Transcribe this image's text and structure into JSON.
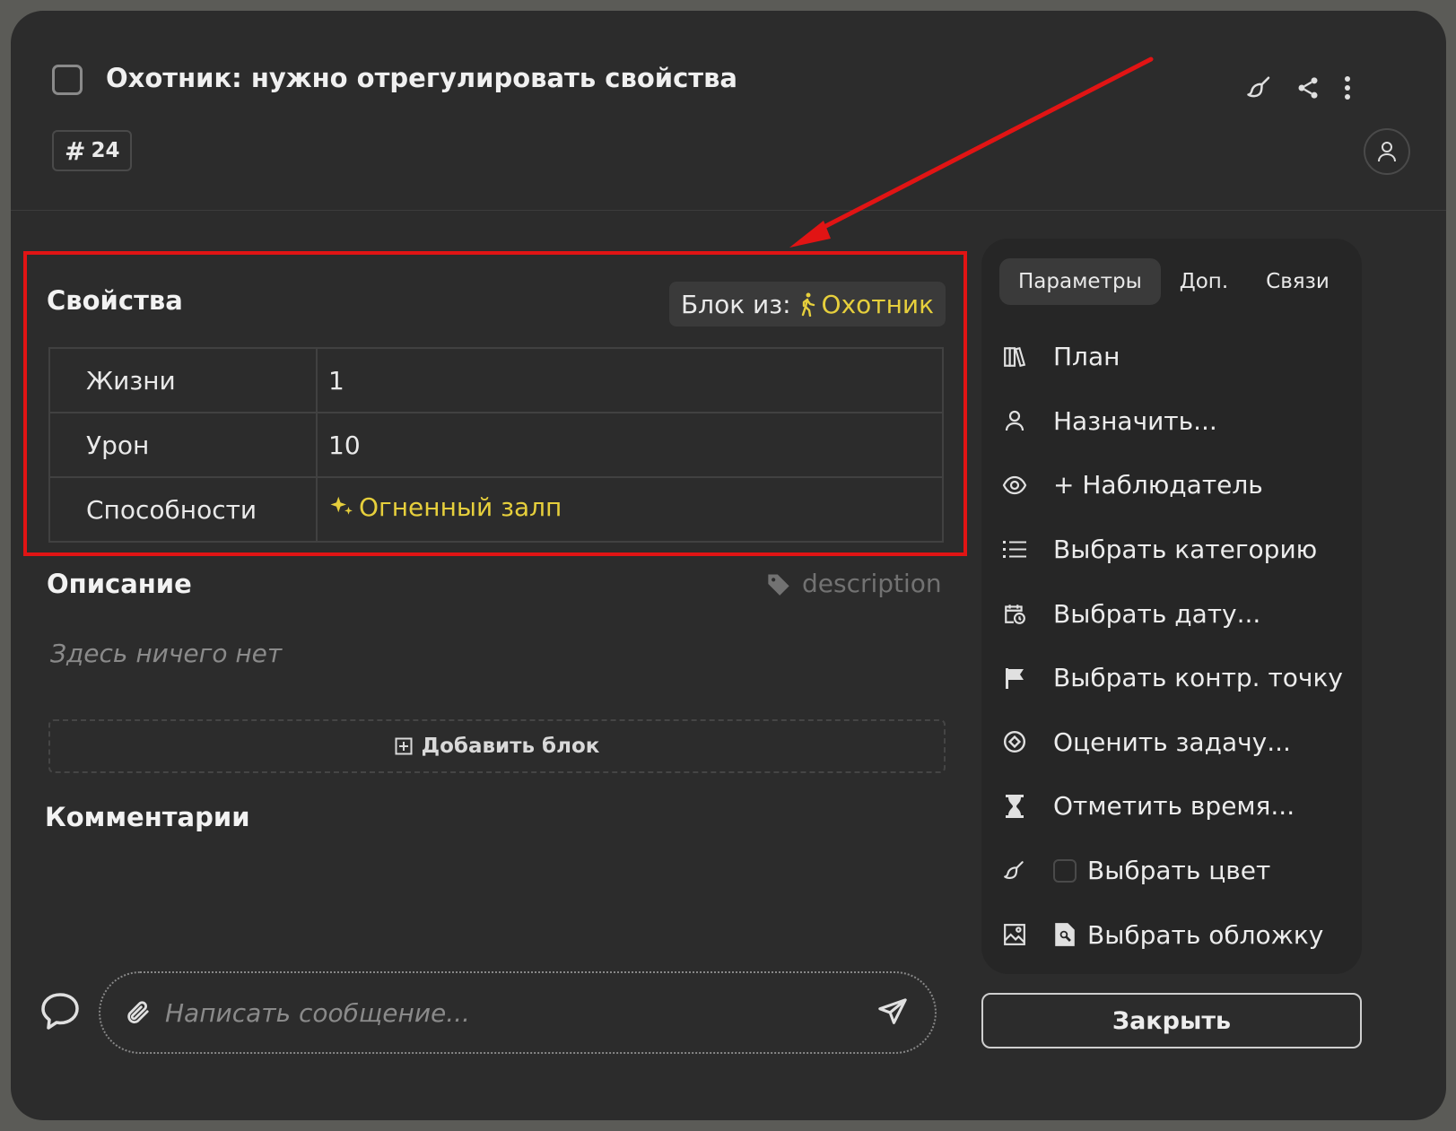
{
  "header": {
    "title": "Охотник: нужно отрегулировать свойства",
    "id_badge_hash": "#",
    "id_badge_number": "24"
  },
  "properties": {
    "title": "Свойства",
    "block_from_label": "Блок из:",
    "block_from_link": "Охотник",
    "rows": [
      {
        "key": "Жизни",
        "value": "1"
      },
      {
        "key": "Урон",
        "value": "10"
      },
      {
        "key": "Способности",
        "value": "Огненный залп"
      }
    ]
  },
  "description": {
    "title": "Описание",
    "tag": "description",
    "empty_text": "Здесь ничего нет"
  },
  "add_block_label": "Добавить блок",
  "comments": {
    "title": "Комментарии",
    "input_placeholder": "Написать сообщение..."
  },
  "side": {
    "tabs": [
      "Параметры",
      "Доп.",
      "Связи"
    ],
    "active_tab": "Параметры",
    "items": [
      {
        "label": "План",
        "icon": "books-icon"
      },
      {
        "label": "Назначить...",
        "icon": "user-icon"
      },
      {
        "label": "+ Наблюдатель",
        "icon": "eye-icon"
      },
      {
        "label": "Выбрать категорию",
        "icon": "list-icon"
      },
      {
        "label": "Выбрать дату...",
        "icon": "calendar-clock-icon"
      },
      {
        "label": "Выбрать контр. точку",
        "icon": "flag-icon"
      },
      {
        "label": "Оценить задачу...",
        "icon": "estimate-icon"
      },
      {
        "label": "Отметить время...",
        "icon": "hourglass-icon"
      },
      {
        "label": "Выбрать цвет",
        "icon": "paint-icon"
      },
      {
        "label": "Выбрать обложку",
        "icon": "image-icon"
      }
    ]
  },
  "close_button": "Закрыть",
  "colors": {
    "background": "#2c2c2c",
    "accent_yellow": "#e6cf3c",
    "highlight_red": "#e11414"
  }
}
